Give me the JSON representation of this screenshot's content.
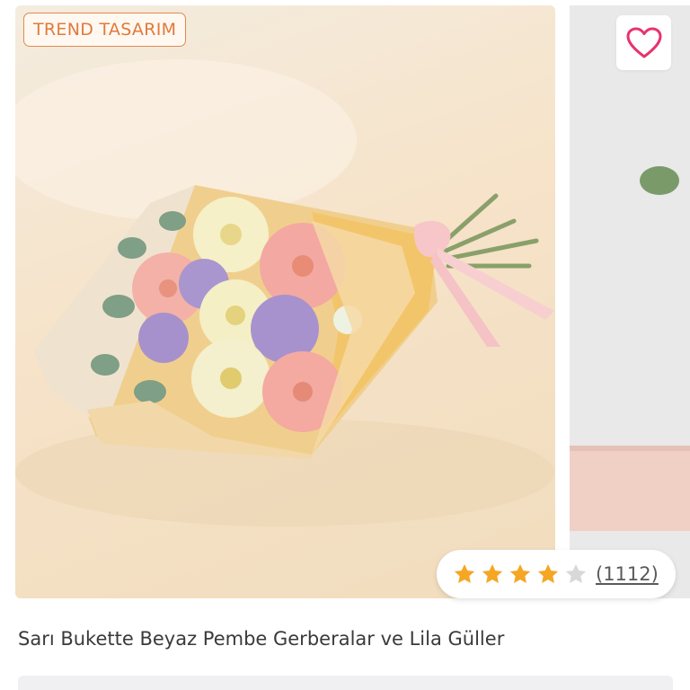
{
  "product": {
    "badge": "TREND TASARIM",
    "title": "Sarı Bukette Beyaz Pembe Gerberalar ve Lila Güller",
    "rating": 4,
    "rating_max": 5,
    "review_count": "(1112)",
    "favorite_icon": "heart-icon",
    "image_icon": "flower-bouquet-photo"
  },
  "colors": {
    "accent": "#e07a3b",
    "star_filled": "#f5a623",
    "star_empty": "#d8d8d8",
    "heart": "#e8336d"
  }
}
